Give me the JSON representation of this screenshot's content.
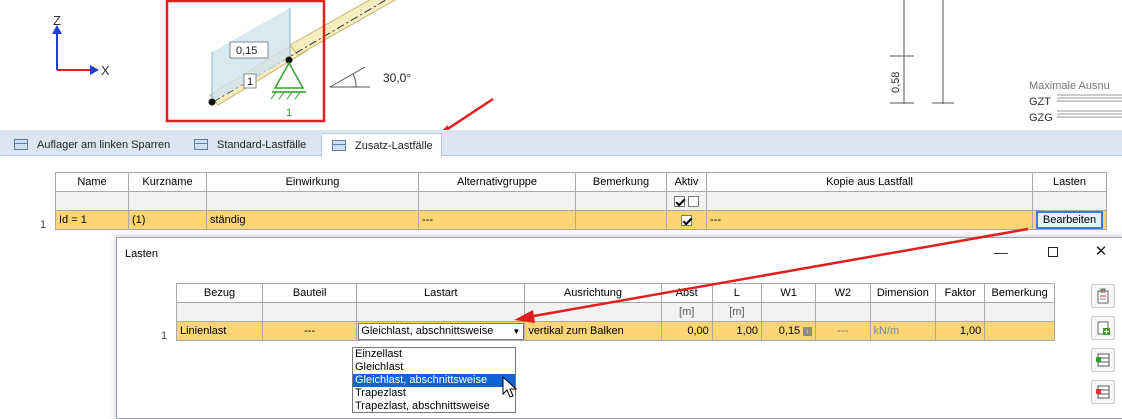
{
  "drawing": {
    "axis_z": "Z",
    "axis_x": "X",
    "load_value": "0,15",
    "member_no": "1",
    "support_no": "1",
    "angle": "30,0°",
    "dim_value": "0,58",
    "ausnutzung_label": "Maximale Ausnu",
    "gzt": "GZT",
    "gzg": "GZG"
  },
  "tabs": [
    {
      "label": "Auflager am linken Sparren",
      "active": false
    },
    {
      "label": "Standard-Lastfälle",
      "active": false
    },
    {
      "label": "Zusatz-Lastfälle",
      "active": true
    }
  ],
  "lastfall_table": {
    "columns": [
      "Name",
      "Kurzname",
      "Einwirkung",
      "Alternativgruppe",
      "Bemerkung",
      "Aktiv",
      "Kopie aus Lastfall",
      "Lasten"
    ],
    "row": {
      "num": "1",
      "name": "Id = 1",
      "kurzname": "(1)",
      "einwirkung": "ständig",
      "alternativgruppe": "---",
      "bemerkung": "",
      "kopie": "---",
      "lasten_button": "Bearbeiten"
    }
  },
  "dialog": {
    "title": "Lasten",
    "columns": [
      "Bezug",
      "Bauteil",
      "Lastart",
      "Ausrichtung",
      "Abst",
      "L",
      "W1",
      "W2",
      "Dimension",
      "Faktor",
      "Bemerkung"
    ],
    "units": {
      "abst": "[m]",
      "l": "[m]"
    },
    "row": {
      "num": "1",
      "bezug": "Linienlast",
      "bauteil": "---",
      "lastart": "Gleichlast, abschnittsweise",
      "ausrichtung": "vertikal zum Balken",
      "abst": "0,00",
      "l": "1,00",
      "w1": "0,15",
      "w2": "---",
      "dimension": "kN/m",
      "faktor": "1,00",
      "bemerkung": ""
    },
    "dropdown_options": [
      "Einzellast",
      "Gleichlast",
      "Gleichlast, abschnittsweise",
      "Trapezlast",
      "Trapezlast, abschnittsweise"
    ],
    "dropdown_selected_index": 2
  },
  "colors": {
    "accent_red": "#e02020",
    "selected_row": "#fbd574",
    "highlight": "#0a64d6",
    "support_green": "#2ea02e"
  }
}
